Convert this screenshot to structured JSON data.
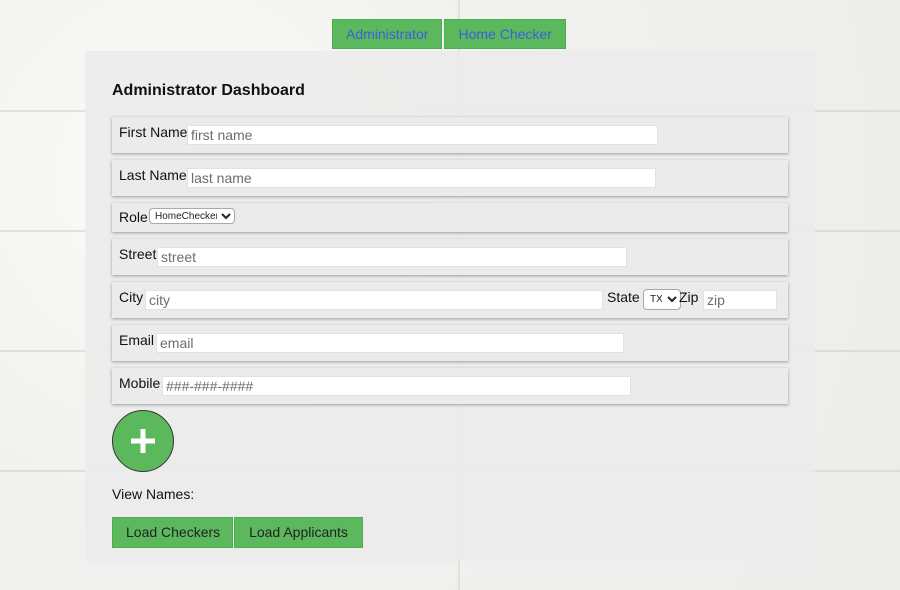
{
  "nav": {
    "tabs": [
      "Administrator",
      "Home Checker"
    ]
  },
  "dashboard": {
    "title": "Administrator Dashboard"
  },
  "form": {
    "first_name": {
      "label": "First Name",
      "placeholder": "first name",
      "value": ""
    },
    "last_name": {
      "label": "Last Name",
      "placeholder": "last name",
      "value": ""
    },
    "role": {
      "label": "Role",
      "selected": "HomeChecker"
    },
    "street": {
      "label": "Street",
      "placeholder": "street",
      "value": ""
    },
    "city": {
      "label": "City",
      "placeholder": "city",
      "value": ""
    },
    "state": {
      "label": "State",
      "selected": "TX"
    },
    "zip": {
      "label": "Zip",
      "placeholder": "zip",
      "value": ""
    },
    "email": {
      "label": "Email",
      "placeholder": "email",
      "value": ""
    },
    "mobile": {
      "label": "Mobile",
      "placeholder": "###-###-####",
      "value": ""
    }
  },
  "add_button": {
    "icon": "plus-icon"
  },
  "view": {
    "label": "View Names:",
    "buttons": [
      "Load Checkers",
      "Load Applicants"
    ]
  },
  "colors": {
    "button_green": "#5cb85c",
    "nav_text_blue": "#3b5fd9",
    "panel_bg": "#ebebeb"
  }
}
